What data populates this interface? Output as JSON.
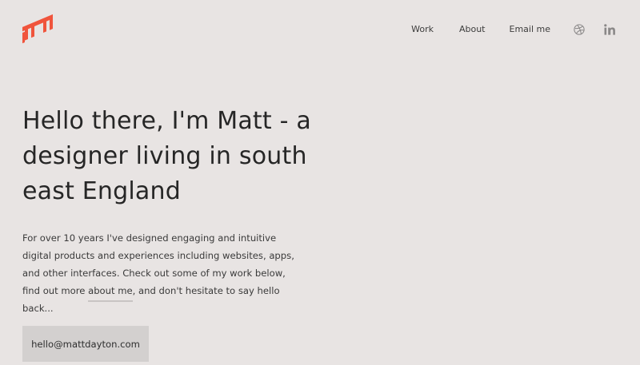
{
  "brand": {
    "accent_color": "#f0543c",
    "logo_icon": "mt-monogram-logo"
  },
  "nav": {
    "items": [
      {
        "label": "Work"
      },
      {
        "label": "About"
      },
      {
        "label": "Email me"
      }
    ],
    "social": [
      {
        "icon": "dribbble-icon"
      },
      {
        "icon": "linkedin-icon",
        "glyph": "in"
      }
    ]
  },
  "hero": {
    "headline": "Hello there, I'm Matt - a designer living in south east England",
    "intro_before_link": "For over 10 years I've designed engaging and intuitive digital products and experiences including websites, apps, and other interfaces. Check out some of my work below, find out more ",
    "intro_link": "about me",
    "intro_after_link": ", and don't hesitate to say hello back...",
    "email_button": "hello@mattdayton.com"
  },
  "colors": {
    "background": "#e8e4e3",
    "button_background": "#d3d0cf",
    "text": "#2b2b2b"
  }
}
